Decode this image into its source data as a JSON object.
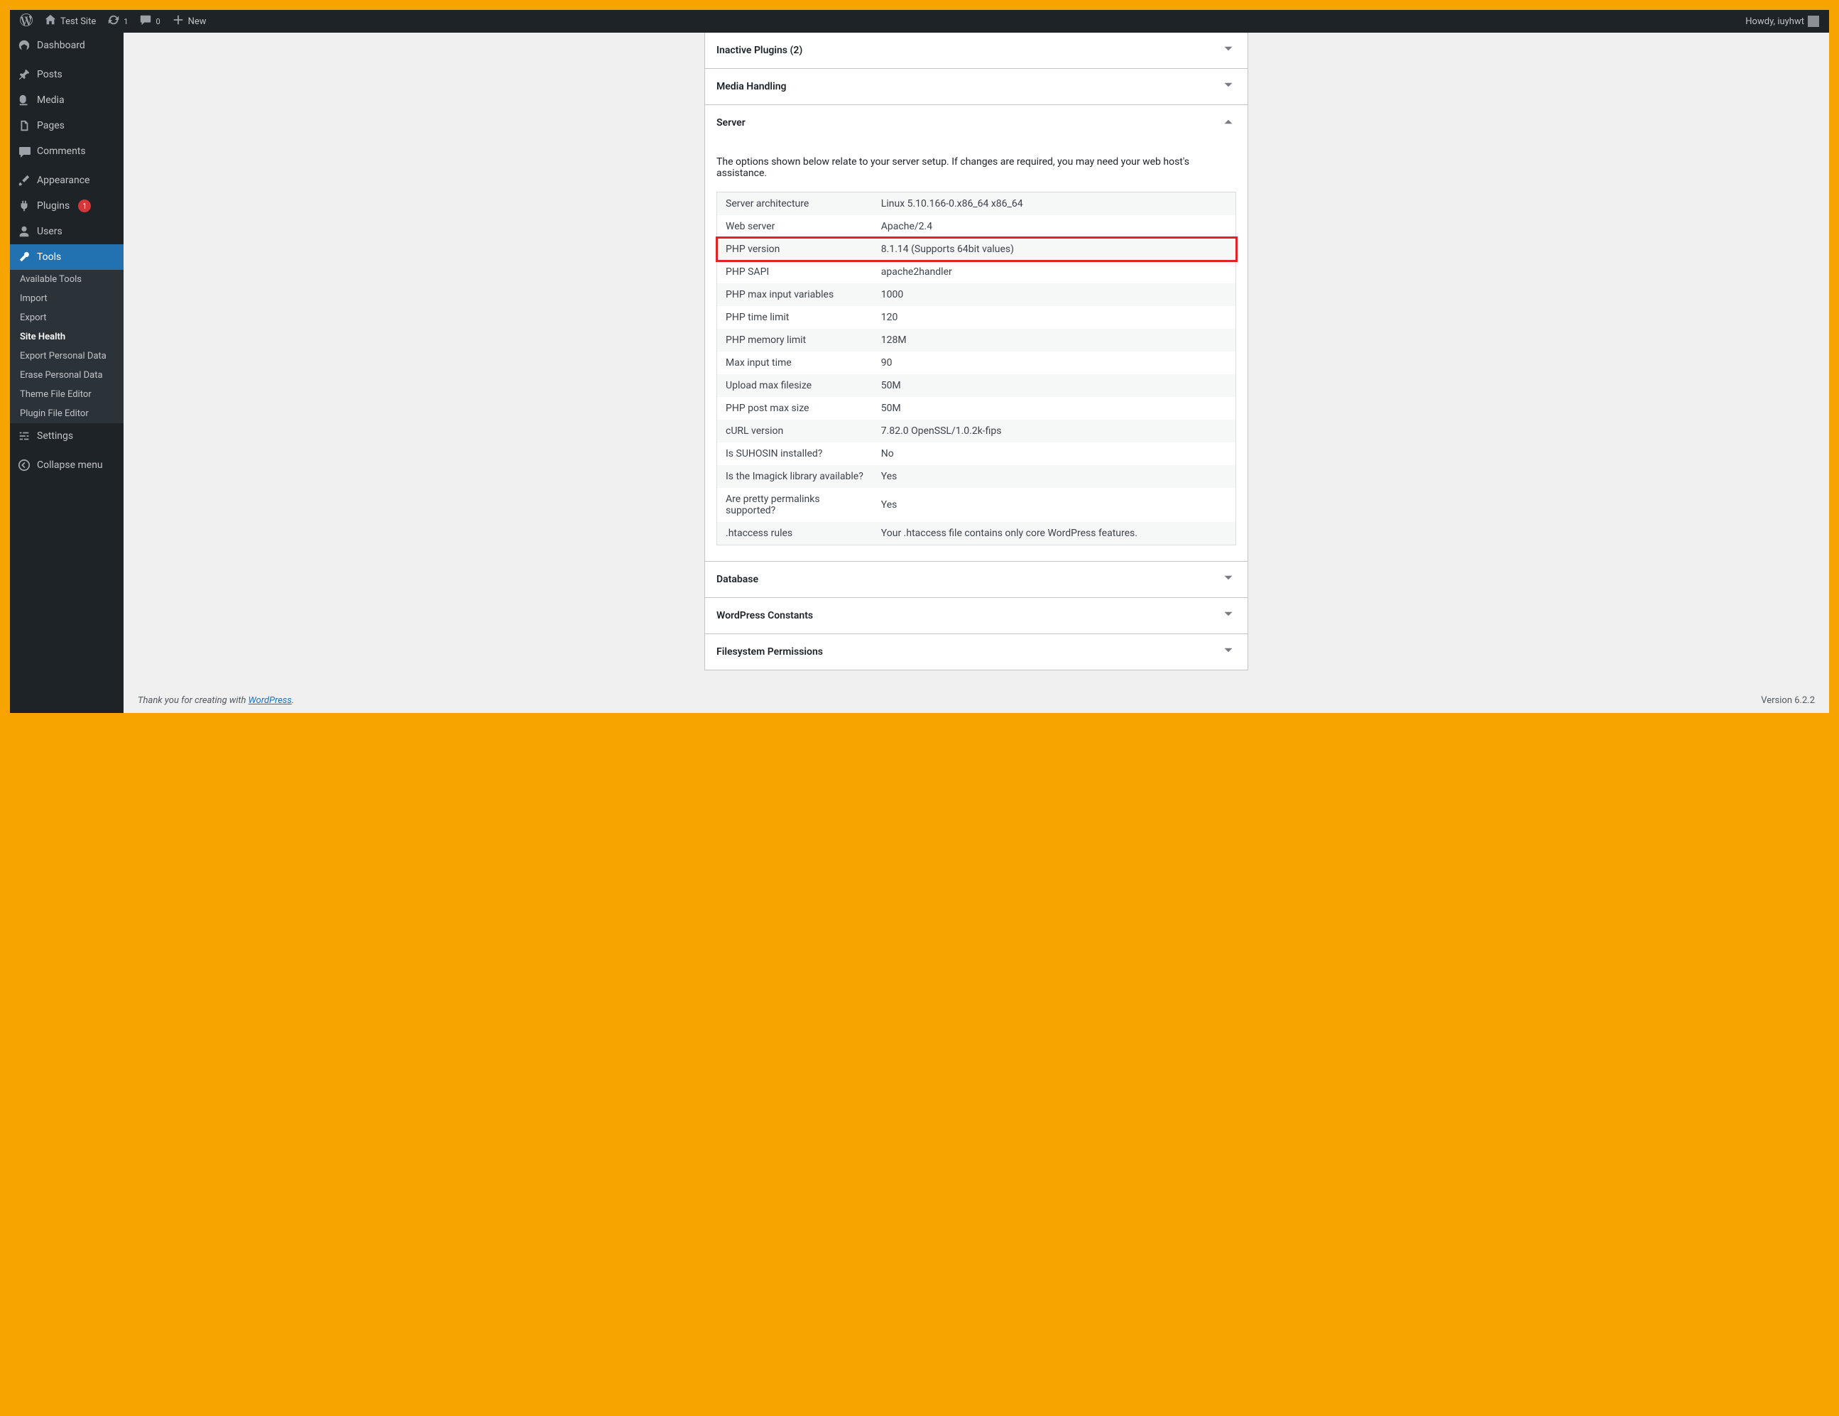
{
  "adminbar": {
    "site_name": "Test Site",
    "updates_count": "1",
    "comments_count": "0",
    "new_label": "New",
    "howdy": "Howdy, iuyhwt"
  },
  "sidebar": {
    "dashboard": "Dashboard",
    "posts": "Posts",
    "media": "Media",
    "pages": "Pages",
    "comments": "Comments",
    "appearance": "Appearance",
    "plugins": "Plugins",
    "plugins_badge": "1",
    "users": "Users",
    "tools": "Tools",
    "settings": "Settings",
    "collapse": "Collapse menu",
    "tools_sub": {
      "available": "Available Tools",
      "import": "Import",
      "export": "Export",
      "site_health": "Site Health",
      "export_personal": "Export Personal Data",
      "erase_personal": "Erase Personal Data",
      "theme_editor": "Theme File Editor",
      "plugin_editor": "Plugin File Editor"
    }
  },
  "panels": {
    "inactive_plugins": "Inactive Plugins (2)",
    "media_handling": "Media Handling",
    "server": "Server",
    "server_desc": "The options shown below relate to your server setup. If changes are required, you may need your web host's assistance.",
    "database": "Database",
    "wp_constants": "WordPress Constants",
    "fs_permissions": "Filesystem Permissions"
  },
  "server_rows": [
    {
      "label": "Server architecture",
      "value": "Linux 5.10.166-0.x86_64 x86_64"
    },
    {
      "label": "Web server",
      "value": "Apache/2.4"
    },
    {
      "label": "PHP version",
      "value": "8.1.14 (Supports 64bit values)"
    },
    {
      "label": "PHP SAPI",
      "value": "apache2handler"
    },
    {
      "label": "PHP max input variables",
      "value": "1000"
    },
    {
      "label": "PHP time limit",
      "value": "120"
    },
    {
      "label": "PHP memory limit",
      "value": "128M"
    },
    {
      "label": "Max input time",
      "value": "90"
    },
    {
      "label": "Upload max filesize",
      "value": "50M"
    },
    {
      "label": "PHP post max size",
      "value": "50M"
    },
    {
      "label": "cURL version",
      "value": "7.82.0 OpenSSL/1.0.2k-fips"
    },
    {
      "label": "Is SUHOSIN installed?",
      "value": "No"
    },
    {
      "label": "Is the Imagick library available?",
      "value": "Yes"
    },
    {
      "label": "Are pretty permalinks supported?",
      "value": "Yes"
    },
    {
      "label": ".htaccess rules",
      "value": "Your .htaccess file contains only core WordPress features."
    }
  ],
  "highlight_index": 2,
  "footer": {
    "thank_prefix": "Thank you for creating with ",
    "wp_link": "WordPress",
    "version": "Version 6.2.2"
  }
}
